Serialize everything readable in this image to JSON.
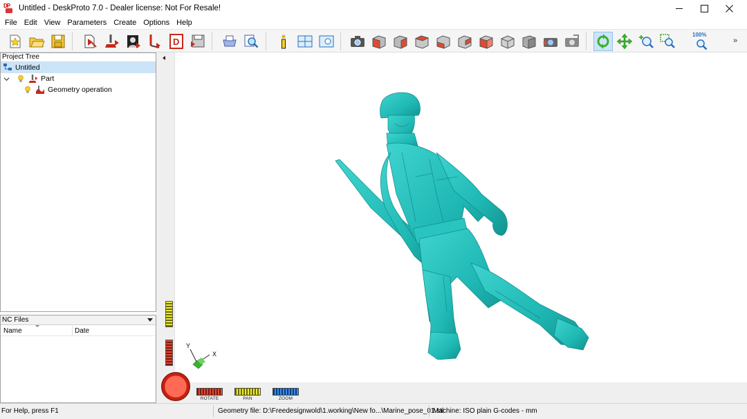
{
  "window": {
    "title": "Untitled - DeskProto 7.0 - Dealer license: Not For Resale!",
    "icon_text": "DP"
  },
  "menu": [
    "File",
    "Edit",
    "View",
    "Parameters",
    "Create",
    "Options",
    "Help"
  ],
  "toolbar": {
    "icons": [
      "new-project-icon",
      "open-project-icon",
      "save-project-icon",
      "part-parameters-icon",
      "operation-parameters-icon",
      "bitmap-icon",
      "vector-icon",
      "drawing-icon",
      "create-nc-icon",
      "print-icon",
      "preview-icon",
      "info-icon",
      "window-layout-icon",
      "view-settings-icon",
      "screenshot-icon",
      "view-front-icon",
      "view-back-icon",
      "view-left-icon",
      "view-right-icon",
      "view-top-icon",
      "view-bottom-icon",
      "view-iso-icon",
      "view-iso2-icon",
      "snapshot-red-icon",
      "snapshot-gray-icon",
      "rotate-mode-icon",
      "pan-mode-icon",
      "zoom-mode-icon",
      "zoom-window-icon",
      "zoom-100-icon"
    ],
    "zoom_100_label": "100%",
    "more_label": "»"
  },
  "project_tree": {
    "header": "Project Tree",
    "items": [
      {
        "label": "Untitled",
        "selected": true
      },
      {
        "label": "Part",
        "expanded": true
      },
      {
        "label": "Geometry operation"
      }
    ]
  },
  "nc_files": {
    "header": "NC Files",
    "columns": [
      "Name",
      "Date"
    ]
  },
  "viewport": {
    "model_color": "#1fb8b4",
    "axes": {
      "y": "Y",
      "x": "X"
    },
    "wheels": {
      "rotate": "ROTATE",
      "pan": "PAN",
      "zoom": "ZOOM"
    }
  },
  "statusbar": {
    "help": "For Help, press F1",
    "geometry": "Geometry file: D:\\Freedesignwold\\1.working\\New fo...\\Marine_pose_01.stl",
    "machine": "Machine: ISO plain G-codes - mm"
  }
}
